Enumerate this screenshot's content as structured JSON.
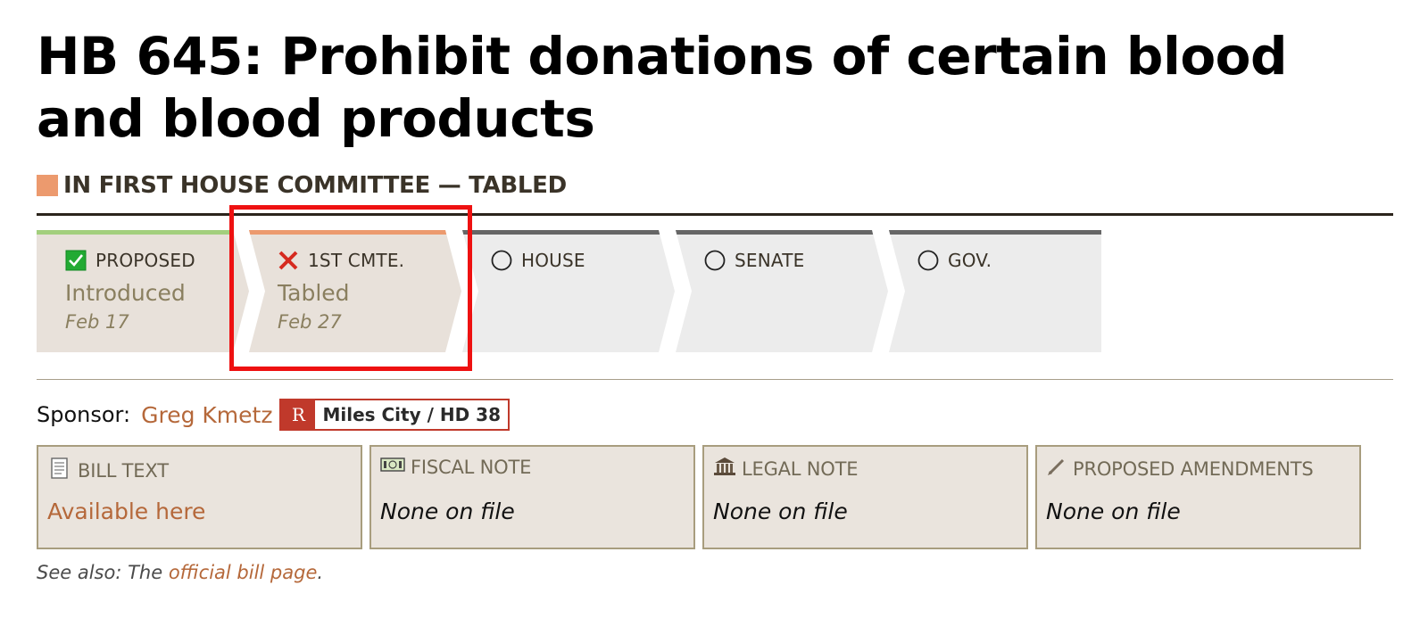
{
  "bill": {
    "title": "HB 645: Prohibit donations of certain blood and blood products",
    "status_banner": "IN FIRST HOUSE COMMITTEE — TABLED",
    "status_color": "#ec9a6e"
  },
  "stages": [
    {
      "label": "PROPOSED",
      "status": "Introduced",
      "date": "Feb 17",
      "state": "complete",
      "icon": "check-box-icon",
      "accent": "#a3cf7d"
    },
    {
      "label": "1ST CMTE.",
      "status": "Tabled",
      "date": "Feb 27",
      "state": "failed",
      "icon": "red-x-icon",
      "accent": "#ec9a6e"
    },
    {
      "label": "HOUSE",
      "status": "",
      "date": "",
      "state": "pending",
      "icon": "empty-circle-icon",
      "accent": "#666666"
    },
    {
      "label": "SENATE",
      "status": "",
      "date": "",
      "state": "pending",
      "icon": "empty-circle-icon",
      "accent": "#666666"
    },
    {
      "label": "GOV.",
      "status": "",
      "date": "",
      "state": "pending",
      "icon": "empty-circle-icon",
      "accent": "#666666"
    }
  ],
  "sponsor": {
    "label": "Sponsor:",
    "name": "Greg Kmetz",
    "party": "R",
    "district": "Miles City / HD 38",
    "party_color": "#c0392b"
  },
  "documents": [
    {
      "label": "BILL TEXT",
      "value": "Available here",
      "icon": "scroll-document-icon",
      "available": true
    },
    {
      "label": "FISCAL NOTE",
      "value": "None on file",
      "icon": "money-bill-icon",
      "available": false
    },
    {
      "label": "LEGAL NOTE",
      "value": "None on file",
      "icon": "courthouse-icon",
      "available": false
    },
    {
      "label": "PROPOSED AMENDMENTS",
      "value": "None on file",
      "icon": "pen-icon",
      "available": false
    }
  ],
  "see_also": {
    "prefix": "See also: The ",
    "link_text": "official bill page",
    "suffix": "."
  }
}
